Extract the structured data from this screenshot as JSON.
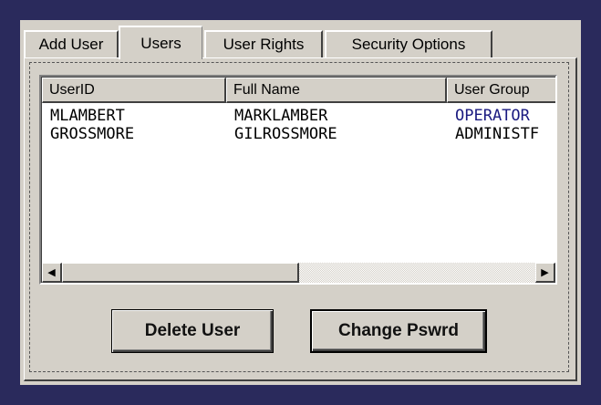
{
  "tabs": [
    {
      "label": "Add User",
      "active": false
    },
    {
      "label": "Users",
      "active": true
    },
    {
      "label": "User Rights",
      "active": false
    },
    {
      "label": "Security Options",
      "active": false
    }
  ],
  "list": {
    "columns": [
      "UserID",
      "Full Name",
      "User Group"
    ],
    "rows": [
      {
        "user_id": "MLAMBERT",
        "full_name": "MARKLAMBER",
        "user_group": "OPERATOR",
        "group_color": "#1a1a80"
      },
      {
        "user_id": "GROSSMORE",
        "full_name": "GILROSSMORE",
        "user_group": "ADMINISTF",
        "group_color": "#000000"
      }
    ]
  },
  "scrollbar": {
    "left_arrow_icon": "triangle-left-icon",
    "right_arrow_icon": "triangle-right-icon"
  },
  "buttons": {
    "delete_label": "Delete User",
    "change_pswrd_label": "Change Pswrd"
  },
  "colors": {
    "desktop_bg": "#2a2a5c",
    "face": "#d4d0c8"
  }
}
